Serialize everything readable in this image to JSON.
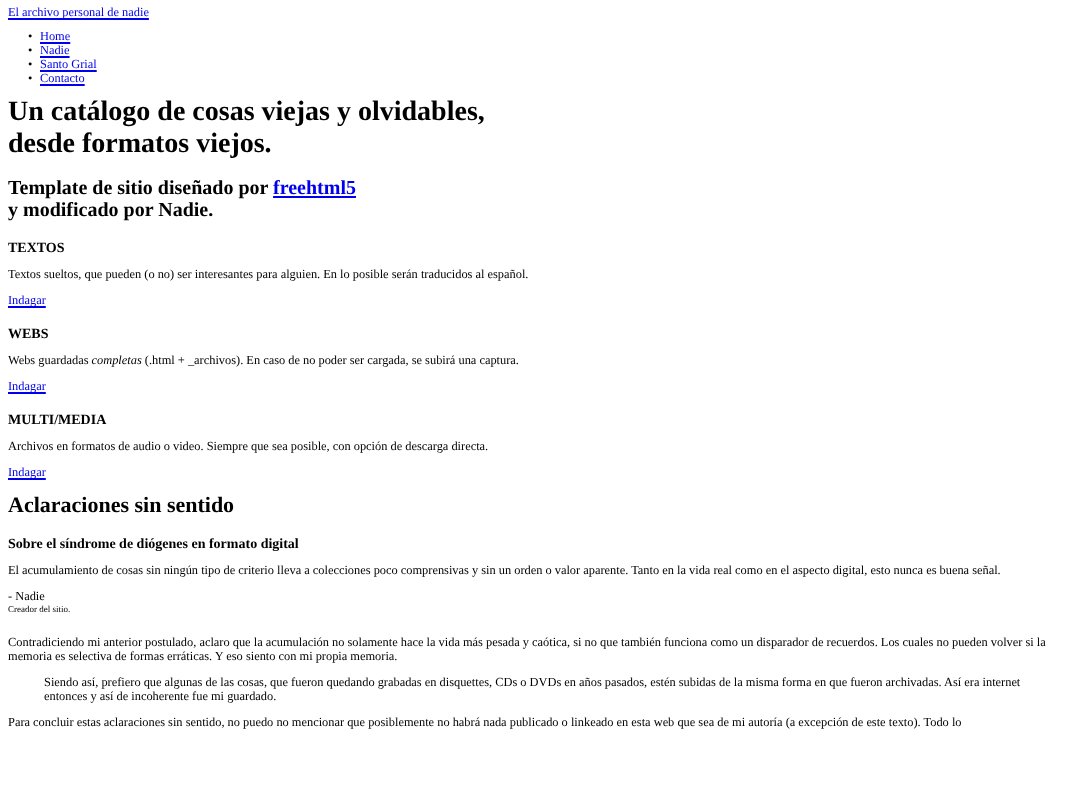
{
  "site_title": "El archivo personal de nadie",
  "nav": [
    {
      "marker": "•",
      "label": "Home"
    },
    {
      "marker": "•",
      "label": "Nadie"
    },
    {
      "marker": "•",
      "label": "Santo Grial"
    },
    {
      "marker": "•",
      "label": "Contacto"
    }
  ],
  "headline": "Un catálogo de cosas viejas y olvidables, desde formatos viejos.",
  "credit": {
    "before": "Template de sitio diseñado por ",
    "link": "freehtml5",
    "after": "y modificado por Nadie."
  },
  "sections": [
    {
      "title": "TEXTOS",
      "text": "Textos sueltos, que pueden (o no) ser interesantes para alguien. En lo posible serán traducidos al español.",
      "link": "Indagar"
    },
    {
      "title": "WEBS",
      "text": "Webs guardadas *completas* (.html + _archivos). En caso de no poder ser cargada, se subirá una captura.",
      "link": "Indagar"
    },
    {
      "title": "MULTI/MEDIA",
      "text": "Archivos en formatos de audio o video. Siempre que sea posible, con opción de descarga directa.",
      "link": "Indagar"
    }
  ],
  "notes": {
    "title": "Aclaraciones sin sentido",
    "subtitle": "Sobre el síndrome de diógenes en formato digital",
    "quote": "El acumulamiento de cosas sin ningún tipo de criterio lleva a colecciones poco comprensivas y sin un orden o valor aparente. Tanto en la vida real como en el aspecto digital, esto nunca es buena señal.",
    "author": "- Nadie",
    "author_role": "Creador del sitio.",
    "paragraph": "Contradiciendo mi anterior postulado, aclaro que la acumulación no solamente hace la vida más pesada y caótica, si no que también funciona como un disparador de recuerdos. Los cuales no pueden volver si la memoria es selectiva de formas erráticas. Y eso siento con mi propia memoria.",
    "blockquote": "Siendo así, prefiero que algunas de las cosas, que fueron quedando grabadas en disquettes, CDs o DVDs en años pasados, estén subidas de la misma forma en que fueron archivadas. Así era internet entonces y así de incoherente fue mi guardado.",
    "closing": "Para concluir estas aclaraciones sin sentido, no puedo no mencionar que posiblemente no habrá nada publicado o linkeado en esta web que sea de mi autoría (a excepción de este texto). Todo lo"
  }
}
